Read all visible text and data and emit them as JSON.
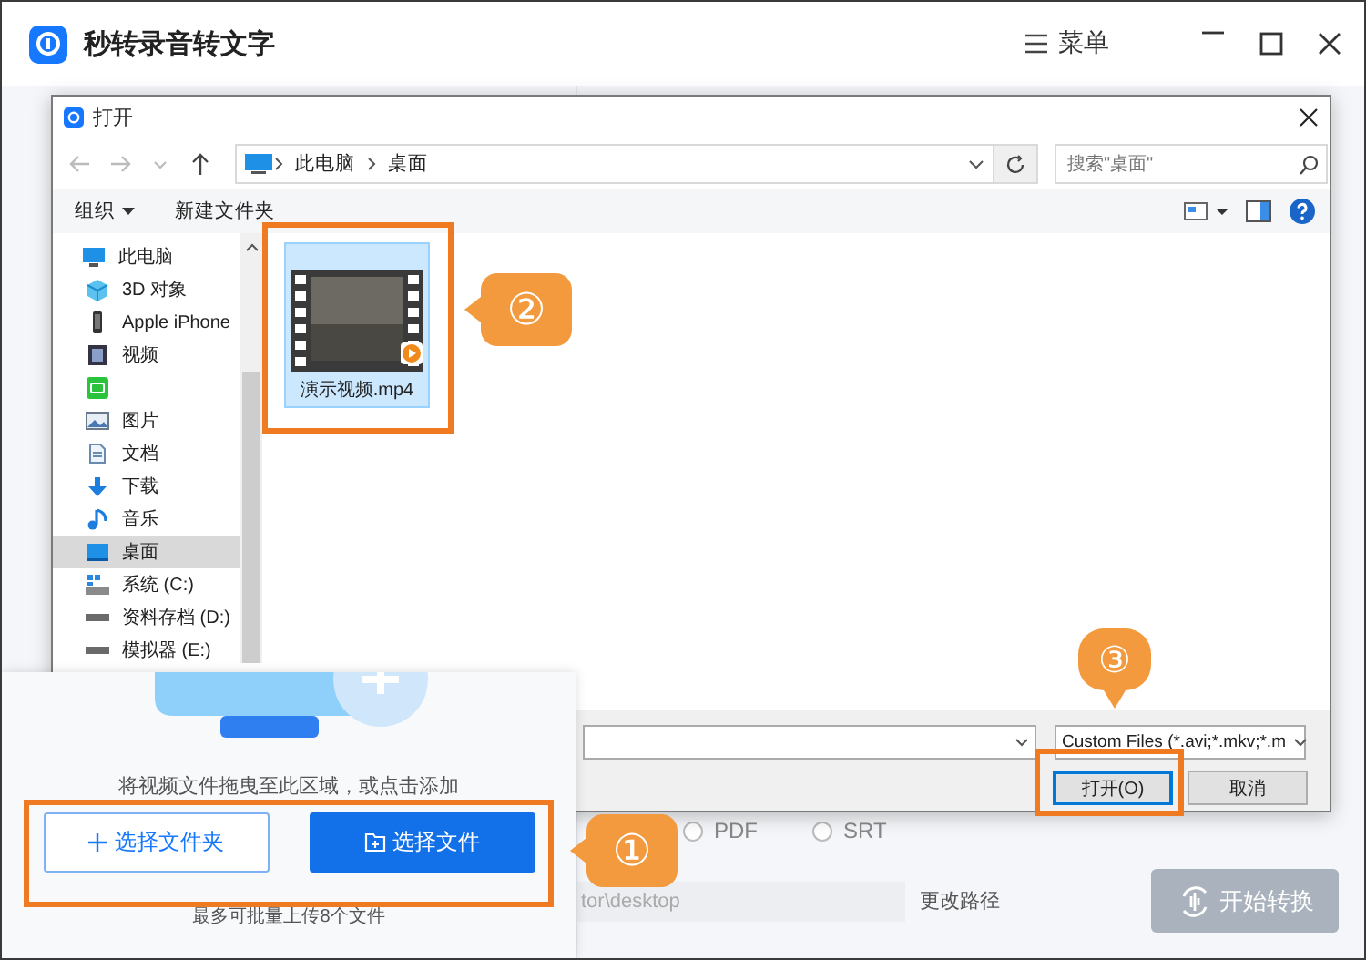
{
  "app": {
    "title": "秒转录音转文字",
    "menu_label": "菜单"
  },
  "settings": {
    "formats": [
      {
        "label": "PDF",
        "selected": false
      },
      {
        "label": "SRT",
        "selected": false
      }
    ],
    "output_path": "tor\\desktop",
    "change_path": "更改路径",
    "start_button": {
      "label": "开始转换",
      "disabled": true
    }
  },
  "upload_panel": {
    "hint": "将视频文件拖曳至此区域，或点击添加",
    "buttons": [
      {
        "label": "选择文件夹",
        "kind": "outline"
      },
      {
        "label": "选择文件",
        "kind": "primary"
      }
    ],
    "note": "最多可批量上传8个文件"
  },
  "dialog": {
    "title": "打开",
    "breadcrumb": [
      "此电脑",
      "桌面"
    ],
    "search": {
      "placeholder": "搜索\"桌面\""
    },
    "toolbar": [
      "组织",
      "新建文件夹"
    ],
    "sidebar": [
      {
        "label": "此电脑",
        "kind": "pc",
        "selected": false,
        "children": [
          {
            "label": "3D 对象",
            "kind": "cube",
            "selected": false
          },
          {
            "label": "Apple iPhone",
            "kind": "phone",
            "selected": false
          },
          {
            "label": "视频",
            "kind": "video",
            "selected": false
          },
          {
            "kind": "app",
            "selected": false
          },
          {
            "label": "图片",
            "kind": "pictures",
            "selected": false
          },
          {
            "label": "文档",
            "kind": "docs",
            "selected": false
          },
          {
            "label": "下载",
            "kind": "download",
            "selected": false
          },
          {
            "label": "音乐",
            "kind": "music",
            "selected": false
          },
          {
            "label": "桌面",
            "kind": "desktop",
            "selected": true
          },
          {
            "label": "系统 (C:)",
            "kind": "system-drive",
            "selected": false
          },
          {
            "label": "资料存档 (D:)",
            "kind": "drive",
            "selected": false
          },
          {
            "label": "模拟器 (E:)",
            "kind": "drive",
            "selected": false
          }
        ]
      }
    ],
    "files": [
      {
        "name": "演示视频.mp4",
        "selected": true
      }
    ],
    "file_type": "Custom Files (*.avi;*.mkv;*.m",
    "buttons": [
      "打开(O)",
      "取消"
    ]
  },
  "callouts": [
    "①",
    "②",
    "③"
  ]
}
